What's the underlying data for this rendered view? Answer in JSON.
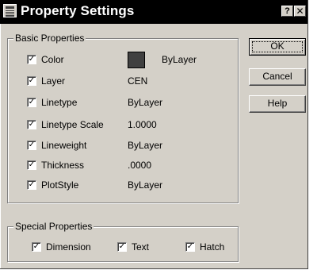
{
  "window": {
    "title": "Property Settings",
    "help_glyph": "?",
    "close_glyph": "✕"
  },
  "basic_properties": {
    "label": "Basic Properties",
    "check_glyph": "✓",
    "items": [
      {
        "label": "Color",
        "value": "ByLayer",
        "checked": true,
        "swatch_color": "#404040"
      },
      {
        "label": "Layer",
        "value": "CEN",
        "checked": true
      },
      {
        "label": "Linetype",
        "value": "ByLayer",
        "checked": true
      },
      {
        "label": "Linetype Scale",
        "value": "1.0000",
        "checked": true
      },
      {
        "label": "Lineweight",
        "value": "ByLayer",
        "checked": true
      },
      {
        "label": "Thickness",
        "value": ".0000",
        "checked": true
      },
      {
        "label": "PlotStyle",
        "value": "ByLayer",
        "checked": true
      }
    ]
  },
  "special_properties": {
    "label": "Special Properties",
    "items": [
      {
        "label": "Dimension",
        "checked": true
      },
      {
        "label": "Text",
        "checked": true
      },
      {
        "label": "Hatch",
        "checked": true
      }
    ]
  },
  "buttons": {
    "ok": "OK",
    "cancel": "Cancel",
    "help": "Help"
  },
  "colors": {
    "title_bar": "#000000",
    "dialog_face": "#d4d0c8"
  }
}
